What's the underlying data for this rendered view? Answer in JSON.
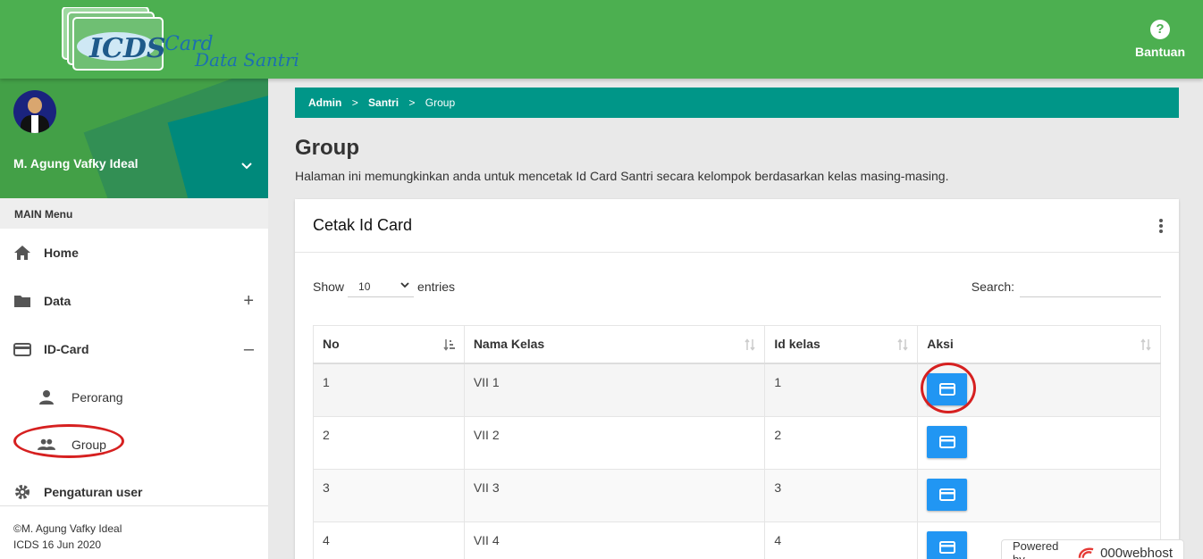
{
  "header": {
    "logo_text": "ICDS",
    "logo_script": "Card Data Santri",
    "help_icon": "question-circle-icon",
    "help_label": "Bantuan"
  },
  "sidebar": {
    "user_name": "M. Agung Vafky Ideal",
    "menu_header": "MAIN Menu",
    "items": [
      {
        "label": "Home",
        "icon": "home-icon"
      },
      {
        "label": "Data",
        "icon": "folder-icon",
        "toggle": "+"
      },
      {
        "label": "ID-Card",
        "icon": "credit-card-icon",
        "toggle": "–"
      },
      {
        "label": "Pengaturan user",
        "icon": "gear-icon"
      }
    ],
    "subitems": [
      {
        "label": "Perorang",
        "icon": "person-icon"
      },
      {
        "label": "Group",
        "icon": "people-icon"
      }
    ],
    "footer_line1": "©M. Agung Vafky Ideal",
    "footer_line2": "ICDS 16 Jun 2020"
  },
  "breadcrumb": {
    "items": [
      "Admin",
      "Santri",
      "Group"
    ],
    "separator": ">"
  },
  "page": {
    "title": "Group",
    "description": "Halaman ini memungkinkan anda untuk mencetak Id Card Santri secara kelompok berdasarkan kelas masing-masing."
  },
  "card": {
    "title": "Cetak Id Card",
    "show_label": "Show",
    "entries_value": "10",
    "entries_label": "entries",
    "search_label": "Search:",
    "columns": [
      "No",
      "Nama Kelas",
      "Id kelas",
      "Aksi"
    ],
    "rows": [
      {
        "no": "1",
        "nama": "VII 1",
        "id": "1"
      },
      {
        "no": "2",
        "nama": "VII 2",
        "id": "2"
      },
      {
        "no": "3",
        "nama": "VII 3",
        "id": "3"
      },
      {
        "no": "4",
        "nama": "VII 4",
        "id": "4"
      }
    ]
  },
  "badge": {
    "prefix": "Powered by",
    "brand": "000webhost"
  },
  "colors": {
    "topbar": "#4caf50",
    "breadcrumb": "#009688",
    "button": "#2196f3",
    "annotation": "#d62020"
  }
}
